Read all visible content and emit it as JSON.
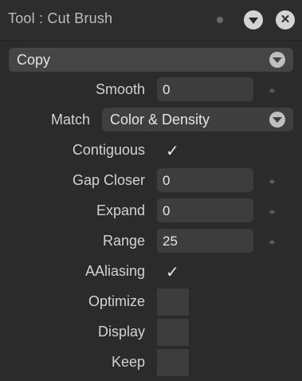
{
  "title": "Tool : Cut Brush",
  "mode_dropdown": {
    "value": "Copy"
  },
  "fields": {
    "smooth": {
      "label": "Smooth",
      "value": "0"
    },
    "match": {
      "label": "Match",
      "value": "Color & Density"
    },
    "contiguous": {
      "label": "Contiguous",
      "checked": true,
      "mark": "✓"
    },
    "gap_closer": {
      "label": "Gap Closer",
      "value": "0"
    },
    "expand": {
      "label": "Expand",
      "value": "0"
    },
    "range": {
      "label": "Range",
      "value": "25"
    },
    "aaliasing": {
      "label": "AAliasing",
      "checked": true,
      "mark": "✓"
    },
    "optimize": {
      "label": "Optimize",
      "checked": false
    },
    "display": {
      "label": "Display",
      "checked": false
    },
    "keep": {
      "label": "Keep",
      "checked": false
    }
  },
  "icons": {
    "status_dot": "dot-icon",
    "collapse": "chevron-down-icon",
    "close": "close-icon",
    "stepper": "stepper-arrows-icon"
  },
  "stepper_glyph": "◂▸",
  "close_glyph": "✕"
}
